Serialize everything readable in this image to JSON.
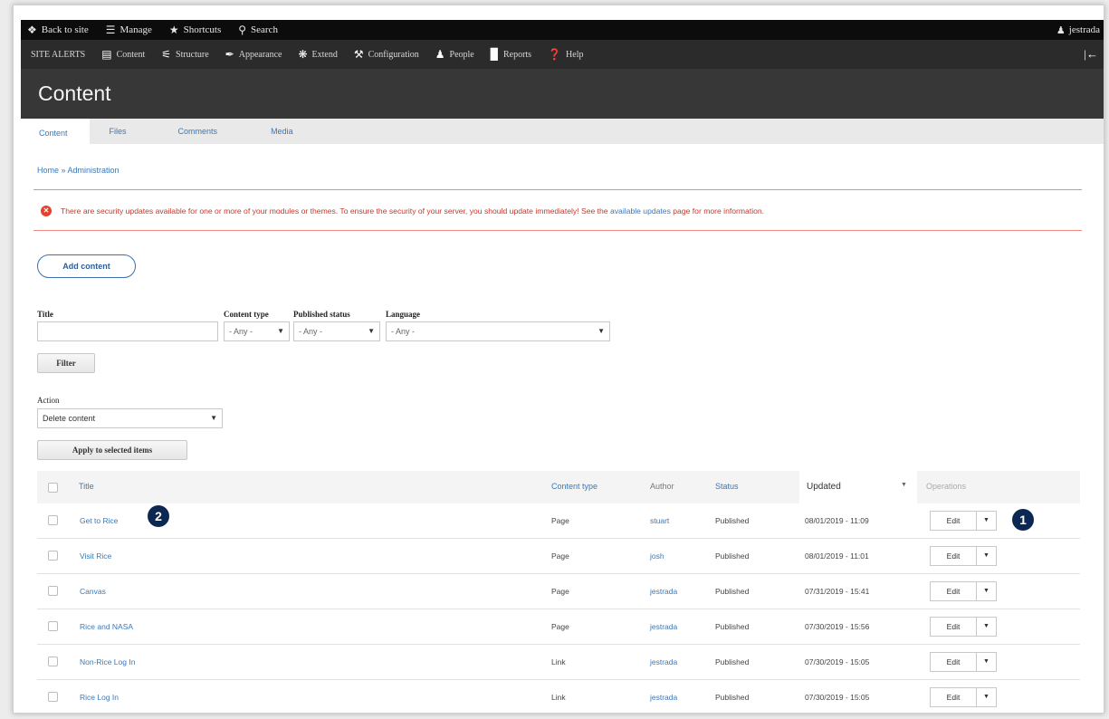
{
  "toolbar": {
    "back_to_site": "Back to site",
    "manage": "Manage",
    "shortcuts": "Shortcuts",
    "search": "Search",
    "user": "jestrada"
  },
  "admin_menu": {
    "items": [
      {
        "label": "SITE ALERTS",
        "icon": ""
      },
      {
        "label": "Content",
        "icon": "content-icon"
      },
      {
        "label": "Structure",
        "icon": "structure-icon"
      },
      {
        "label": "Appearance",
        "icon": "appearance-icon"
      },
      {
        "label": "Extend",
        "icon": "extend-icon"
      },
      {
        "label": "Configuration",
        "icon": "wrench-icon"
      },
      {
        "label": "People",
        "icon": "people-icon"
      },
      {
        "label": "Reports",
        "icon": "reports-icon"
      },
      {
        "label": "Help",
        "icon": "help-icon"
      }
    ]
  },
  "page": {
    "title": "Content"
  },
  "tabs": [
    "Content",
    "Files",
    "Comments",
    "Media"
  ],
  "breadcrumb": "Home » Administration",
  "message": {
    "before": "There are security updates available for one or more of your modules or themes. To ensure the security of your server, you should update immediately! See the ",
    "link": "available updates",
    "after": " page for more information."
  },
  "add_content": "Add content",
  "filters": {
    "title_label": "Title",
    "title_value": "",
    "content_type_label": "Content type",
    "content_type_value": "- Any -",
    "published_label": "Published status",
    "published_value": "- Any -",
    "language_label": "Language",
    "language_value": "- Any -",
    "filter_button": "Filter"
  },
  "action": {
    "label": "Action",
    "value": "Delete content",
    "apply_button": "Apply to selected items"
  },
  "table": {
    "headers": {
      "title": "Title",
      "content_type": "Content type",
      "author": "Author",
      "status": "Status",
      "updated": "Updated",
      "operations": "Operations"
    },
    "rows": [
      {
        "title": "Get to Rice",
        "type": "Page",
        "author": "stuart",
        "status": "Published",
        "updated": "08/01/2019 - 11:09",
        "op": "Edit"
      },
      {
        "title": "Visit Rice",
        "type": "Page",
        "author": "josh",
        "status": "Published",
        "updated": "08/01/2019 - 11:01",
        "op": "Edit"
      },
      {
        "title": "Canvas",
        "type": "Page",
        "author": "jestrada",
        "status": "Published",
        "updated": "07/31/2019 - 15:41",
        "op": "Edit"
      },
      {
        "title": "Rice and NASA",
        "type": "Page",
        "author": "jestrada",
        "status": "Published",
        "updated": "07/30/2019 - 15:56",
        "op": "Edit"
      },
      {
        "title": "Non-Rice Log In",
        "type": "Link",
        "author": "jestrada",
        "status": "Published",
        "updated": "07/30/2019 - 15:05",
        "op": "Edit"
      },
      {
        "title": "Rice Log In",
        "type": "Link",
        "author": "jestrada",
        "status": "Published",
        "updated": "07/30/2019 - 15:05",
        "op": "Edit"
      }
    ]
  },
  "callouts": [
    "1",
    "2"
  ]
}
